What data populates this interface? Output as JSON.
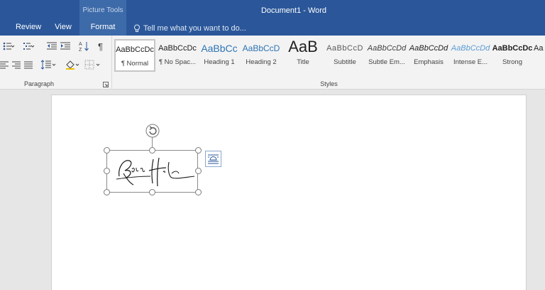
{
  "titlebar": {
    "context_tools": "Picture Tools",
    "document_title": "Document1 - Word"
  },
  "tabs": [
    {
      "label": "Review"
    },
    {
      "label": "View"
    },
    {
      "label": "Format",
      "active": true
    }
  ],
  "tell_me": {
    "placeholder": "Tell me what you want to do...",
    "icon": "lightbulb-icon"
  },
  "paragraph_group": {
    "label": "Paragraph",
    "buttons": [
      "bullets-icon",
      "numbering-icon",
      "multilevel-list-icon",
      "decrease-indent-icon",
      "increase-indent-icon",
      "sort-icon",
      "show-formatting-marks-icon",
      "align-left-icon",
      "center-icon",
      "align-right-icon",
      "justify-icon",
      "line-spacing-icon",
      "shading-icon",
      "borders-icon"
    ]
  },
  "styles_group": {
    "label": "Styles",
    "items": [
      {
        "sample": "AaBbCcDc",
        "name": "¶ Normal",
        "selected": true
      },
      {
        "sample": "AaBbCcDc",
        "name": "¶ No Spac..."
      },
      {
        "sample": "AaBbCc",
        "name": "Heading 1"
      },
      {
        "sample": "AaBbCcD",
        "name": "Heading 2"
      },
      {
        "sample": "AaB",
        "name": "Title"
      },
      {
        "sample": "AaBbCcD",
        "name": "Subtitle"
      },
      {
        "sample": "AaBbCcDd",
        "name": "Subtle Em..."
      },
      {
        "sample": "AaBbCcDd",
        "name": "Emphasis"
      },
      {
        "sample": "AaBbCcDd",
        "name": "Intense E..."
      },
      {
        "sample": "AaBbCcDc",
        "name": "Strong"
      },
      {
        "sample": "Aa",
        "name": ""
      }
    ]
  },
  "document": {
    "selected_object": "signature-image",
    "signature_text": "Robin Hood"
  },
  "colors": {
    "ribbon_blue": "#2b579a",
    "ribbon_bg": "#f3f3f3",
    "page_bg": "#ffffff",
    "heading_blue": "#2e74b5"
  }
}
